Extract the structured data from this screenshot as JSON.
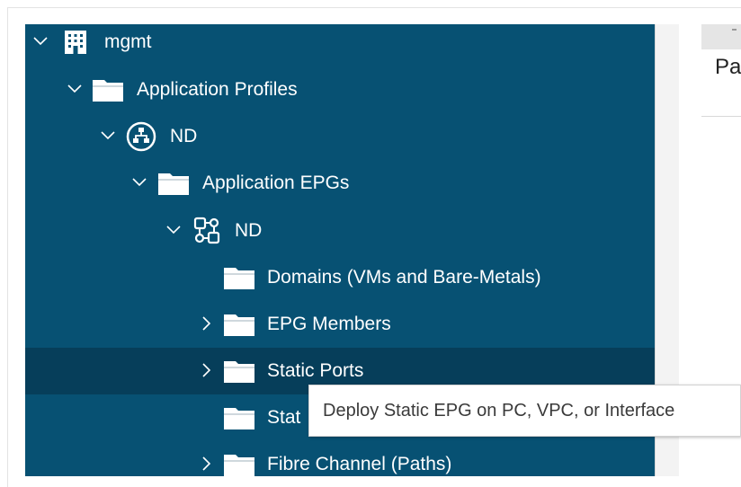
{
  "tree": {
    "nodes": [
      {
        "label": "mgmt",
        "icon": "building-icon",
        "expanded": true
      },
      {
        "label": "Application Profiles",
        "icon": "folder-icon",
        "expanded": true
      },
      {
        "label": "ND",
        "icon": "application-profile-icon",
        "expanded": true
      },
      {
        "label": "Application EPGs",
        "icon": "folder-icon",
        "expanded": true
      },
      {
        "label": "ND",
        "icon": "epg-icon",
        "expanded": true
      },
      {
        "label": "Domains (VMs and Bare-Metals)",
        "icon": "folder-icon"
      },
      {
        "label": "EPG Members",
        "icon": "folder-icon",
        "expanded": false
      },
      {
        "label": "Static Ports",
        "icon": "folder-icon",
        "expanded": false,
        "selected": true
      },
      {
        "label": "Stat",
        "icon": "folder-icon"
      },
      {
        "label": "Fibre Channel (Paths)",
        "icon": "folder-icon",
        "expanded": false
      }
    ]
  },
  "tooltip": {
    "text": "Deploy Static EPG on PC, VPC, or Interface"
  },
  "right_pane": {
    "partial_text": "Pa"
  },
  "colors": {
    "tree_bg": "#075173",
    "selected_bg": "#063e5a",
    "text": "#ffffff"
  }
}
